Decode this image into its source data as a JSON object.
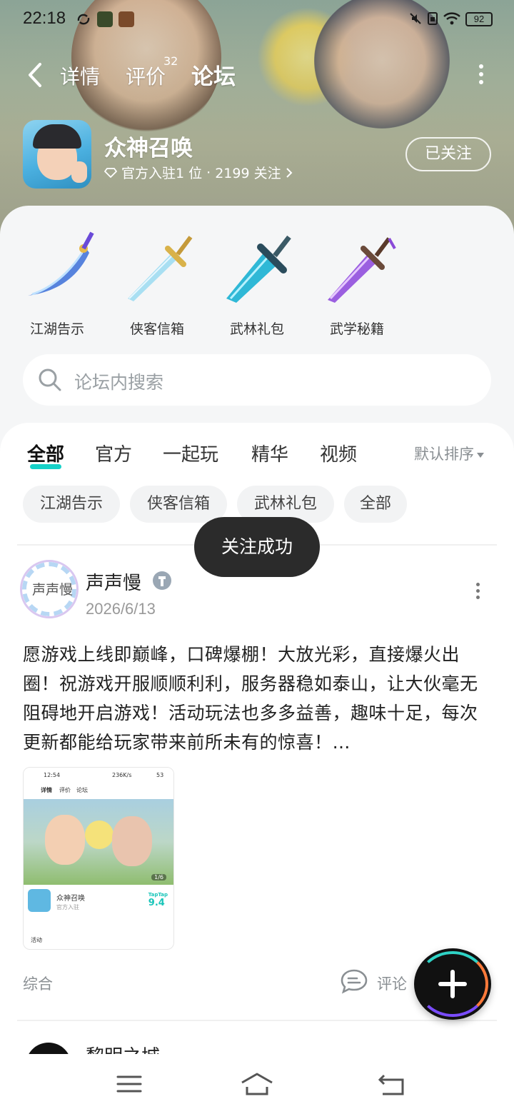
{
  "status_bar": {
    "time": "22:18",
    "battery": "92"
  },
  "nav": {
    "tabs": [
      {
        "label": "详情"
      },
      {
        "label": "评价",
        "badge": "32"
      },
      {
        "label": "论坛",
        "active": true
      }
    ]
  },
  "game": {
    "title": "众神召唤",
    "meta_official": "官方入驻1 位",
    "meta_sep": "·",
    "meta_follow": "2199 关注",
    "follow_button": "已关注"
  },
  "quick_links": [
    {
      "label": "江湖告示",
      "color": "#3b6fd8"
    },
    {
      "label": "侠客信箱",
      "color": "#7fc7e8"
    },
    {
      "label": "武林礼包",
      "color": "#2fb8d6"
    },
    {
      "label": "武学秘籍",
      "color": "#9b5fe0"
    }
  ],
  "search": {
    "placeholder": "论坛内搜索"
  },
  "feed_tabs": [
    {
      "label": "全部",
      "active": true
    },
    {
      "label": "官方"
    },
    {
      "label": "一起玩"
    },
    {
      "label": "精华"
    },
    {
      "label": "视频"
    }
  ],
  "sort_label": "默认排序",
  "chips": [
    "江湖告示",
    "侠客信箱",
    "武林礼包",
    "全部"
  ],
  "toast": "关注成功",
  "post": {
    "author": "声声慢",
    "avatar_text": "声声慢",
    "date": "2026/6/13",
    "text": "愿游戏上线即巅峰，口碑爆棚！大放光彩，直接爆火出圈！祝游戏开服顺顺利利，服务器稳如泰山，让大伙毫无阻碍地开启游戏！活动玩法也多多益善，趣味十足，每次更新都能给玩家带来前所未有的惊喜！…",
    "category": "综合",
    "comment_label": "评论",
    "thumb": {
      "time": "12:54",
      "speed": "236K/s",
      "battery": "53",
      "tabs": [
        "详情",
        "评价",
        "论坛"
      ],
      "game_name": "众神召唤",
      "official": "官方入驻",
      "score_brand": "TapTap",
      "score": "9.4",
      "page": "1/6",
      "event": "活动"
    }
  },
  "next_post": {
    "author": "黎明之城"
  },
  "colors": {
    "accent": "#16d1c8",
    "toast_bg": "#2b2b2b"
  }
}
